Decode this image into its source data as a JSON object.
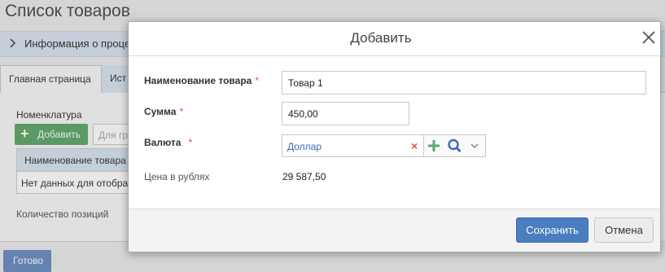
{
  "background": {
    "title": "Список товаров",
    "info_section_label": "Информация о проце",
    "tabs": [
      {
        "label": "Главная страница"
      },
      {
        "label": "Ист"
      }
    ],
    "nomenclature_label": "Номенклатура",
    "add_button_label": "Добавить",
    "group_placeholder": "Для гр",
    "table_header": "Наименование товара",
    "table_empty": "Нет данных для отобра",
    "count_label": "Количество позиций",
    "done_button_label": "Готово"
  },
  "dialog": {
    "title": "Добавить",
    "fields": {
      "name": {
        "label": "Наименование товара",
        "required_mark": "*",
        "value": "Товар 1"
      },
      "amount": {
        "label": "Сумма",
        "required_mark": "*",
        "value": "450,00"
      },
      "currency": {
        "label": "Валюта",
        "required_mark": "*",
        "value": "Доллар",
        "clear_symbol": "×"
      },
      "price_rub": {
        "label": "Цена в рублях",
        "value": "29 587,50"
      }
    },
    "buttons": {
      "save": "Сохранить",
      "cancel": "Отмена"
    }
  },
  "colors": {
    "accent": "#4a7ec0",
    "add_green": "#5ea86a",
    "required_red": "#d9534f",
    "link_blue": "#3d6ab3"
  },
  "icons": {
    "close": "close-icon",
    "chevron": "chevron-right-icon",
    "plus": "plus-icon",
    "search": "search-icon",
    "dropdown": "chevron-down-icon",
    "clear": "clear-icon"
  }
}
